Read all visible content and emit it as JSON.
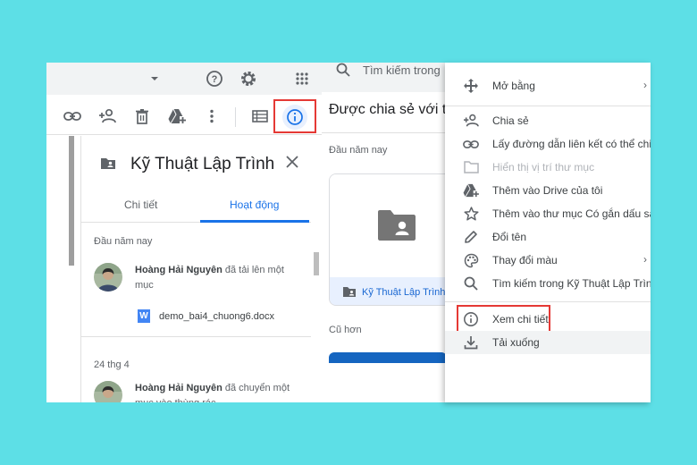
{
  "left_panel": {
    "folder_title": "Kỹ Thuật Lập Trình",
    "tabs": [
      {
        "label": "Chi tiết",
        "active": false
      },
      {
        "label": "Hoạt động",
        "active": true
      }
    ],
    "activity": [
      {
        "section": "Đầu năm nay",
        "user": "Hoàng Hải Nguyên",
        "action": "đã tải lên một mục",
        "file": "demo_bai4_chuong6.docx"
      },
      {
        "section": "24 thg 4",
        "user": "Hoàng Hải Nguyên",
        "action": "đã chuyển một mục vào thùng rác"
      }
    ],
    "icons": {
      "header": [
        "dropdown-caret-icon",
        "help-icon",
        "settings-icon",
        "apps-grid-icon"
      ],
      "toolbar": [
        "link-icon",
        "add-person-icon",
        "trash-icon",
        "add-to-drive-icon",
        "more-vert-icon",
        "list-view-icon",
        "info-icon"
      ]
    },
    "highlight_color": "#e53935",
    "accent_color": "#1a73e8"
  },
  "middle_panel": {
    "search_placeholder": "Tìm kiếm trong",
    "heading": "Được chia sẻ với tôi",
    "section_recent": "Đầu năm nay",
    "folder_card_name": "Kỹ Thuật Lập Trình",
    "section_older": "Cũ hơn"
  },
  "context_menu": {
    "items": [
      {
        "label": "Mở bằng",
        "icon": "move-arrows-icon",
        "submenu": true
      },
      {
        "label": "Chia sẻ",
        "icon": "add-person-icon"
      },
      {
        "label": "Lấy đường dẫn liên kết có thể chia",
        "icon": "link-icon"
      },
      {
        "label": "Hiển thị vị trí thư mục",
        "icon": "folder-outline-icon",
        "disabled": true
      },
      {
        "label": "Thêm vào Drive của tôi",
        "icon": "add-to-drive-icon"
      },
      {
        "label": "Thêm vào thư mục Có gắn dấu sao",
        "icon": "star-outline-icon"
      },
      {
        "label": "Đổi tên",
        "icon": "pencil-icon"
      },
      {
        "label": "Thay đổi màu",
        "icon": "palette-icon",
        "submenu": true
      },
      {
        "label": "Tìm kiếm trong Kỹ Thuật Lập Trình",
        "icon": "search-icon"
      },
      {
        "label": "Xem chi tiết",
        "icon": "info-icon",
        "highlighted": true
      },
      {
        "label": "Tải xuống",
        "icon": "download-icon",
        "hovered": true
      }
    ],
    "chevron": "›"
  }
}
